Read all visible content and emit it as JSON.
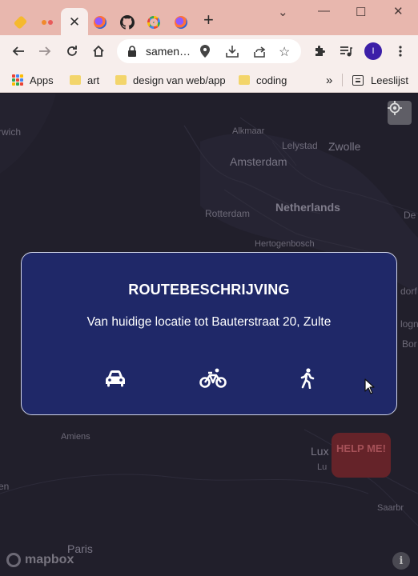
{
  "browser": {
    "address": "samen…",
    "avatar_initial": "I",
    "bookmarks": [
      {
        "label": "Apps",
        "icon": "apps-grid-icon"
      },
      {
        "label": "art",
        "icon": "folder-icon"
      },
      {
        "label": "design van web/app",
        "icon": "folder-icon"
      },
      {
        "label": "coding",
        "icon": "folder-icon"
      }
    ],
    "overflow_label": "»",
    "reading_list_label": "Leeslijst"
  },
  "map": {
    "places": [
      {
        "label": "rwich"
      },
      {
        "label": "Alkmaar"
      },
      {
        "label": "Lelystad"
      },
      {
        "label": "Zwolle"
      },
      {
        "label": "Amsterdam"
      },
      {
        "label": "Rotterdam"
      },
      {
        "label": "Netherlands"
      },
      {
        "label": "Hertogenbosch"
      },
      {
        "label": "Amiens"
      },
      {
        "label": "Lux"
      },
      {
        "label": "Lu"
      },
      {
        "label": "en"
      },
      {
        "label": "Paris"
      },
      {
        "label": "Saarbr"
      },
      {
        "label": "dorf"
      },
      {
        "label": "logn"
      },
      {
        "label": "Bor"
      },
      {
        "label": "De"
      }
    ],
    "attribution": "mapbox",
    "help_button": "HELP ME!"
  },
  "modal": {
    "title": "ROUTEBESCHRIJVING",
    "subtitle": "Van huidige locatie tot Bauterstraat 20, Zulte",
    "modes": [
      {
        "name": "car",
        "icon": "car-icon"
      },
      {
        "name": "bike",
        "icon": "bicycle-icon"
      },
      {
        "name": "walk",
        "icon": "walking-icon"
      }
    ]
  },
  "colors": {
    "tab_strip": "#e8b7ae",
    "toolbar": "#f7eeec",
    "map_background": "#211f2b",
    "modal_background": "#1f2868",
    "help_button": "#652329"
  }
}
